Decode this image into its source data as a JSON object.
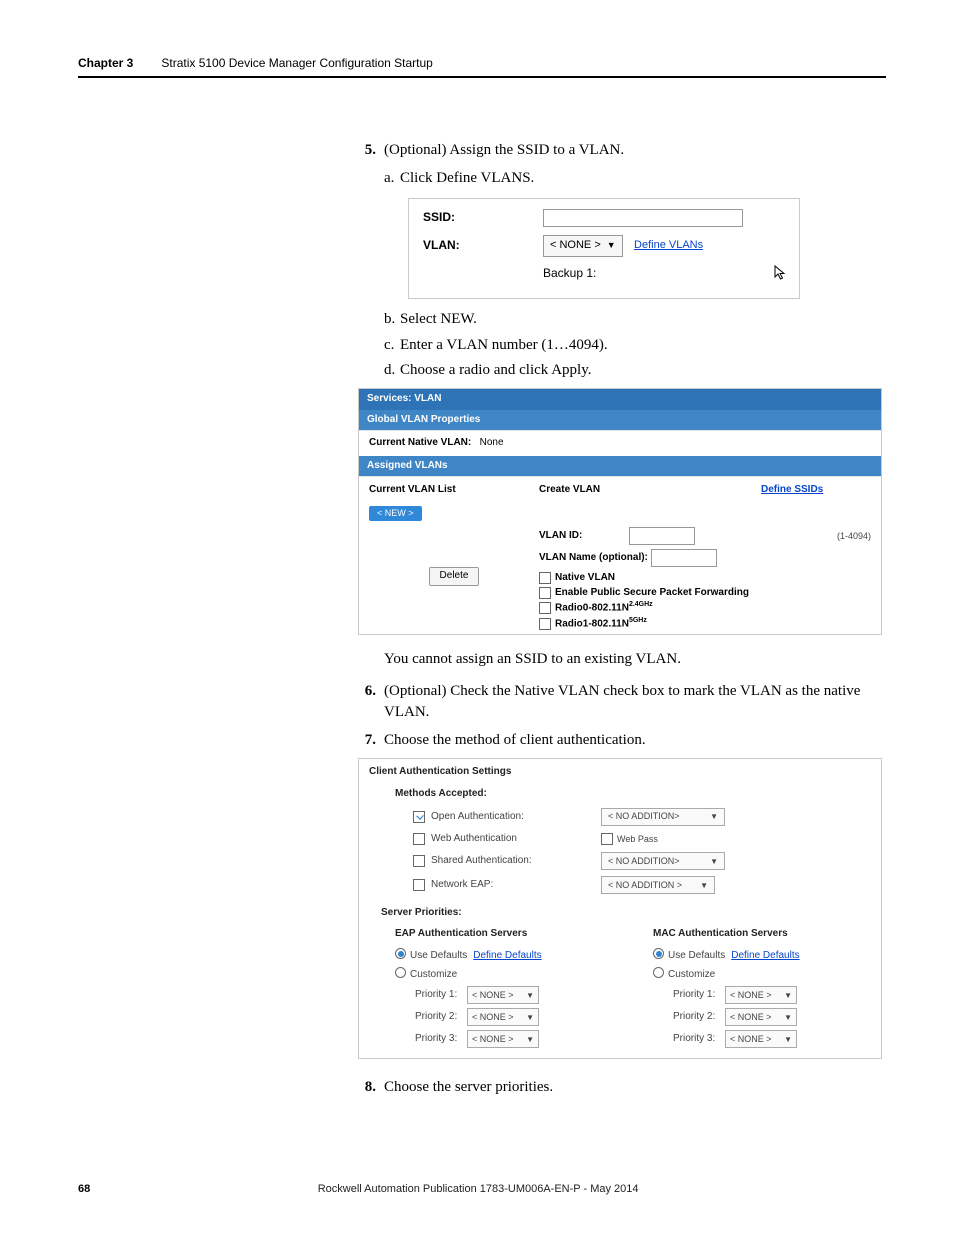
{
  "header": {
    "chapter": "Chapter 3",
    "title": "Stratix 5100 Device Manager Configuration Startup"
  },
  "steps": {
    "s5": {
      "num": "5.",
      "text": "(Optional) Assign the SSID to a VLAN.",
      "a": "Click Define VLANS.",
      "b": "Select NEW.",
      "c": "Enter a VLAN number (1…4094).",
      "d": "Choose a radio and click Apply."
    },
    "s6_num": "6.",
    "s6": "(Optional) Check the Native VLAN check box to mark the VLAN as the native VLAN.",
    "s7_num": "7.",
    "s7": "Choose the method of client authentication.",
    "s8_num": "8.",
    "s8": "Choose the server priorities."
  },
  "note": "You cannot assign an SSID to an existing VLAN.",
  "shot1": {
    "ssid_label": "SSID:",
    "vlan_label": "VLAN:",
    "select_value": "< NONE >",
    "define_link": "Define VLANs",
    "backup_label": "Backup 1:"
  },
  "shot2": {
    "title": "Services: VLAN",
    "gvp": "Global VLAN Properties",
    "cnv_label": "Current Native VLAN:",
    "cnv_value": "None",
    "assigned": "Assigned VLANs",
    "cvl": "Current VLAN List",
    "create": "Create VLAN",
    "define_ssids": "Define SSIDs",
    "new_btn": "< NEW >",
    "delete": "Delete",
    "vlan_id": "VLAN ID:",
    "range": "(1-4094)",
    "vlan_name": "VLAN Name (optional):",
    "native": "Native VLAN",
    "epspf": "Enable Public Secure Packet Forwarding",
    "radio0a": "Radio0-802.11N",
    "radio0b": "2.4GHz",
    "radio1a": "Radio1-802.11N",
    "radio1b": "5GHz"
  },
  "shot3": {
    "title": "Client Authentication Settings",
    "methods": "Methods Accepted:",
    "rows": {
      "open": "Open Authentication:",
      "web": "Web Authentication",
      "shared": "Shared Authentication:",
      "eap": "Network EAP:"
    },
    "no_add1": "< NO ADDITION>",
    "web_pass": "Web Pass",
    "no_add2": "< NO ADDITION>",
    "no_add3": "< NO ADDITION >",
    "sp": "Server Priorities:",
    "eap_hdr": "EAP Authentication Servers",
    "mac_hdr": "MAC Authentication Servers",
    "use_def": "Use Defaults",
    "def_link": "Define Defaults",
    "customize": "Customize",
    "p1": "Priority 1:",
    "p2": "Priority 2:",
    "p3": "Priority 3:",
    "none": "< NONE >"
  },
  "footer": {
    "page": "68",
    "pub": "Rockwell Automation Publication 1783-UM006A-EN-P - May 2014"
  }
}
